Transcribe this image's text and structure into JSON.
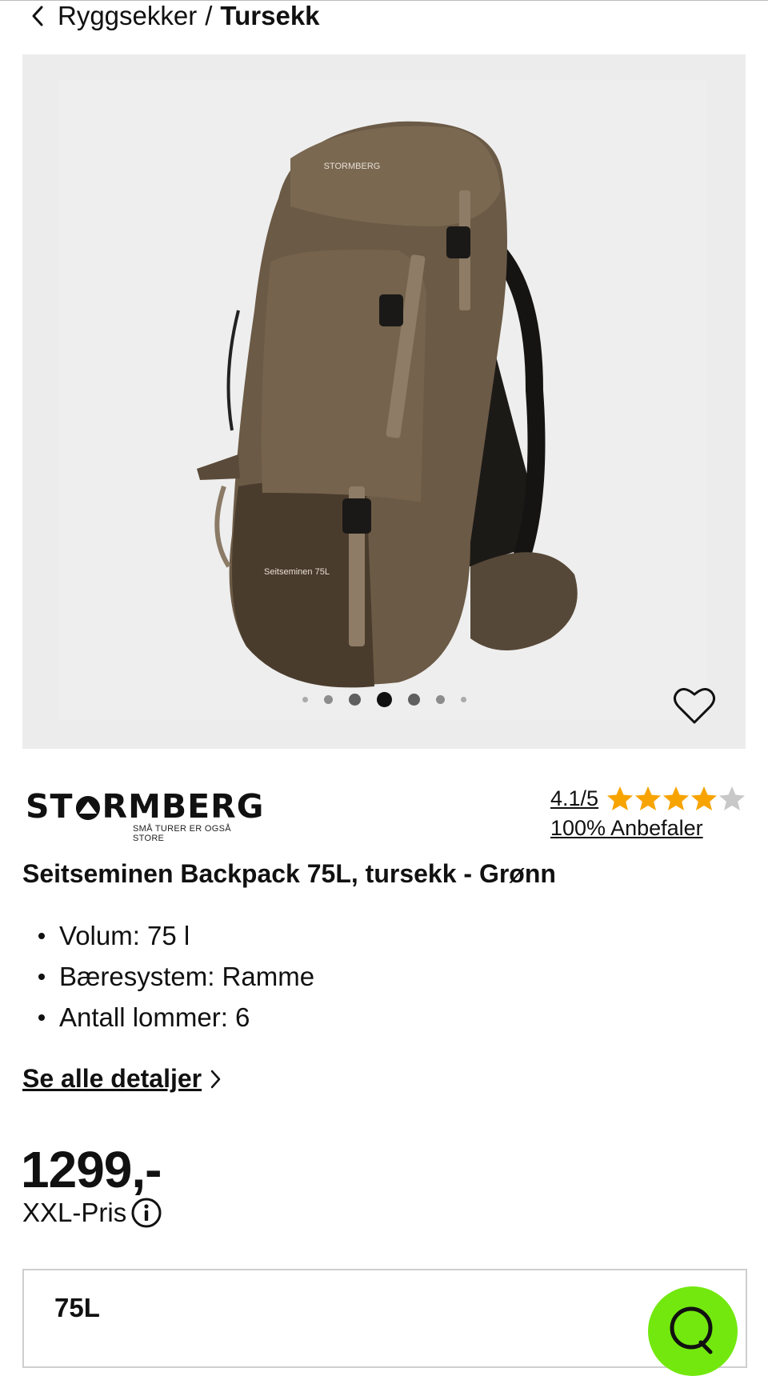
{
  "breadcrumb": {
    "parent": "Ryggsekker",
    "separator": "/",
    "current": "Tursekk"
  },
  "gallery": {
    "image_alt": "Seitseminen Backpack 75L",
    "print_brand": "STORMBERG",
    "print_model": "Seitseminen 75L",
    "dot_count": 7,
    "active_index": 3
  },
  "brand": {
    "name_left": "ST",
    "name_right": "RMBERG",
    "tagline": "SMÅ TURER ER OGSÅ STORE"
  },
  "rating": {
    "score": "4.1/5",
    "stars_filled": 4,
    "stars_total": 5,
    "recommend": "100% Anbefaler"
  },
  "product": {
    "title": "Seitseminen Backpack 75L, tursekk - Grønn",
    "specs": [
      "Volum: 75 l",
      "Bæresystem: Ramme",
      "Antall lommer: 6"
    ],
    "details_link": "Se alle detaljer",
    "price": "1299,-",
    "price_label": "XXL-Pris"
  },
  "variant": {
    "selected": "75L"
  },
  "colors": {
    "accent_chat": "#73e80e",
    "star": "#f7a400",
    "star_empty": "#c8c8c8",
    "gallery_bg": "#ececec"
  },
  "icons": [
    "chevron-left-icon",
    "heart-icon",
    "star-icon",
    "info-icon",
    "chevron-right-icon",
    "chat-icon"
  ]
}
